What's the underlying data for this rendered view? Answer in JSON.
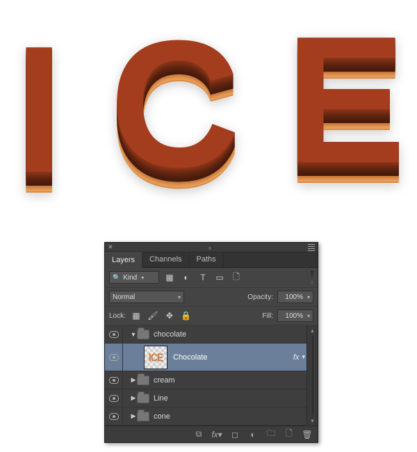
{
  "artwork": {
    "text": "ICE"
  },
  "panel": {
    "tabs": {
      "layers": "Layers",
      "channels": "Channels",
      "paths": "Paths"
    },
    "filter": {
      "kind_icon": "search-icon",
      "kind_label": "Kind",
      "img_icon": "image-filter-icon",
      "adj_icon": "adjustment-filter-icon",
      "type_icon": "type-filter-icon",
      "shape_icon": "shape-filter-icon",
      "smart_icon": "smart-filter-icon"
    },
    "blend": {
      "mode": "Normal",
      "opacity_label": "Opacity:",
      "opacity_value": "100%"
    },
    "lock": {
      "label": "Lock:",
      "fill_label": "Fill:",
      "fill_value": "100%"
    },
    "layers": [
      {
        "type": "group",
        "expanded": true,
        "name": "chocolate"
      },
      {
        "type": "layer",
        "selected": true,
        "name": "Chocolate",
        "thumb_text": "ICE",
        "has_fx": true,
        "fx_label": "fx"
      },
      {
        "type": "group",
        "expanded": false,
        "name": "cream"
      },
      {
        "type": "group",
        "expanded": false,
        "name": "Line"
      },
      {
        "type": "group",
        "expanded": false,
        "name": "cone"
      }
    ],
    "footer": {
      "link": "link-icon",
      "fx": "fx-icon",
      "mask": "mask-icon",
      "adjust": "adjustment-icon",
      "group": "new-group-icon",
      "new": "new-layer-icon",
      "trash": "trash-icon"
    }
  }
}
